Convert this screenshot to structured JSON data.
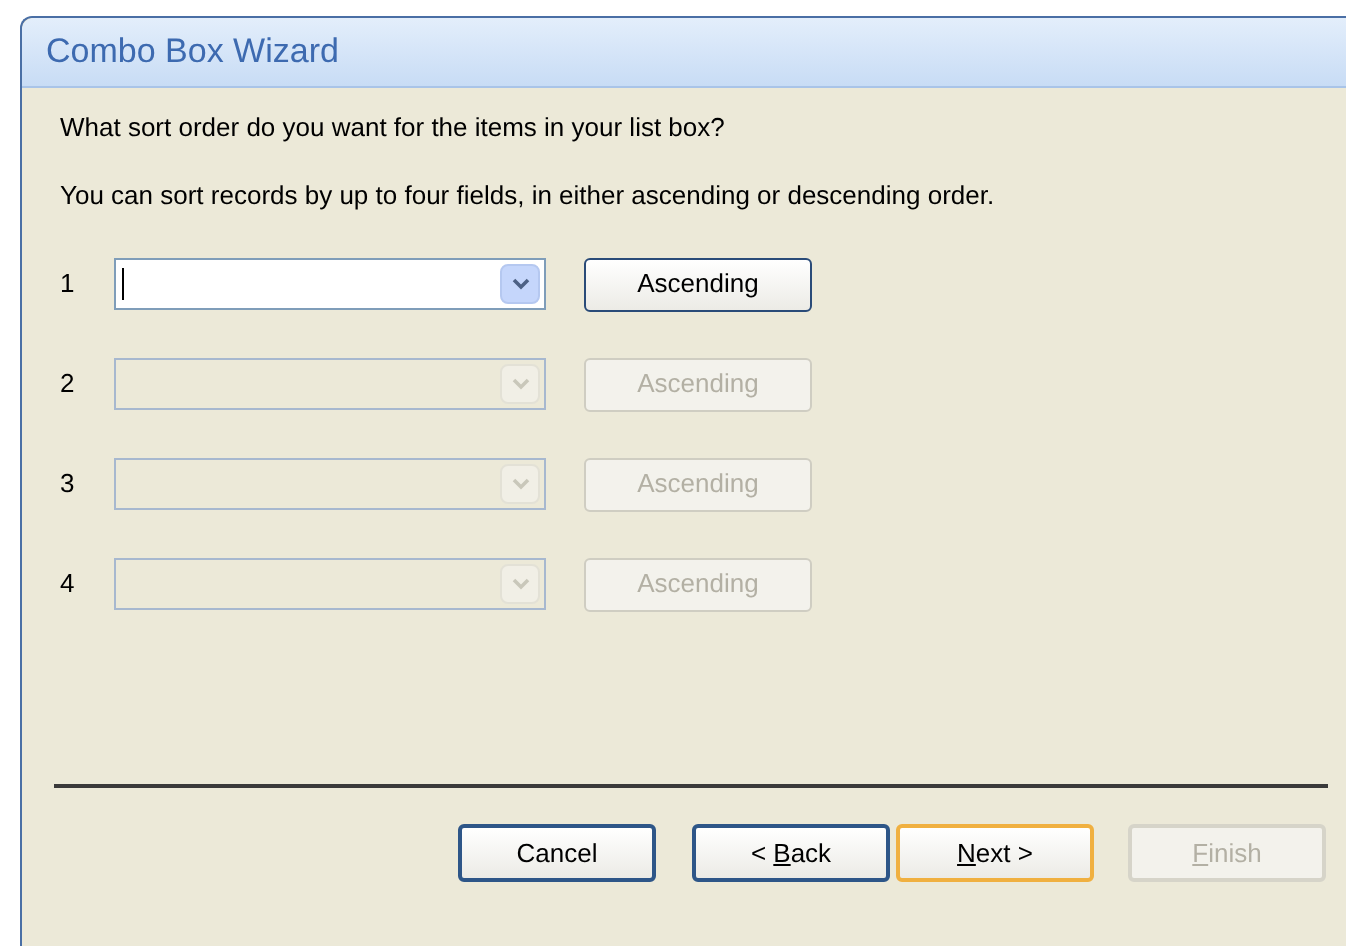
{
  "window": {
    "title": "Combo Box Wizard"
  },
  "question": "What sort order do you want for the items in your list box?",
  "instructions": "You can sort records by up to four fields, in either ascending or descending order.",
  "sort_fields": [
    {
      "number": "1",
      "disabled": false,
      "focused": true,
      "order_button": "Ascending"
    },
    {
      "number": "2",
      "disabled": true,
      "focused": false,
      "order_button": "Ascending"
    },
    {
      "number": "3",
      "disabled": true,
      "focused": false,
      "order_button": "Ascending"
    },
    {
      "number": "4",
      "disabled": true,
      "focused": false,
      "order_button": "Ascending"
    }
  ],
  "buttons": [
    {
      "before": "Cancel",
      "disabled": false,
      "default": false
    },
    {
      "before": "< ",
      "access_key": "B",
      "after": "ack",
      "disabled": false,
      "default": false
    },
    {
      "access_key": "N",
      "after": "ext >",
      "disabled": false,
      "default": true
    },
    {
      "access_key": "F",
      "after": "inish",
      "disabled": true,
      "default": false
    }
  ]
}
